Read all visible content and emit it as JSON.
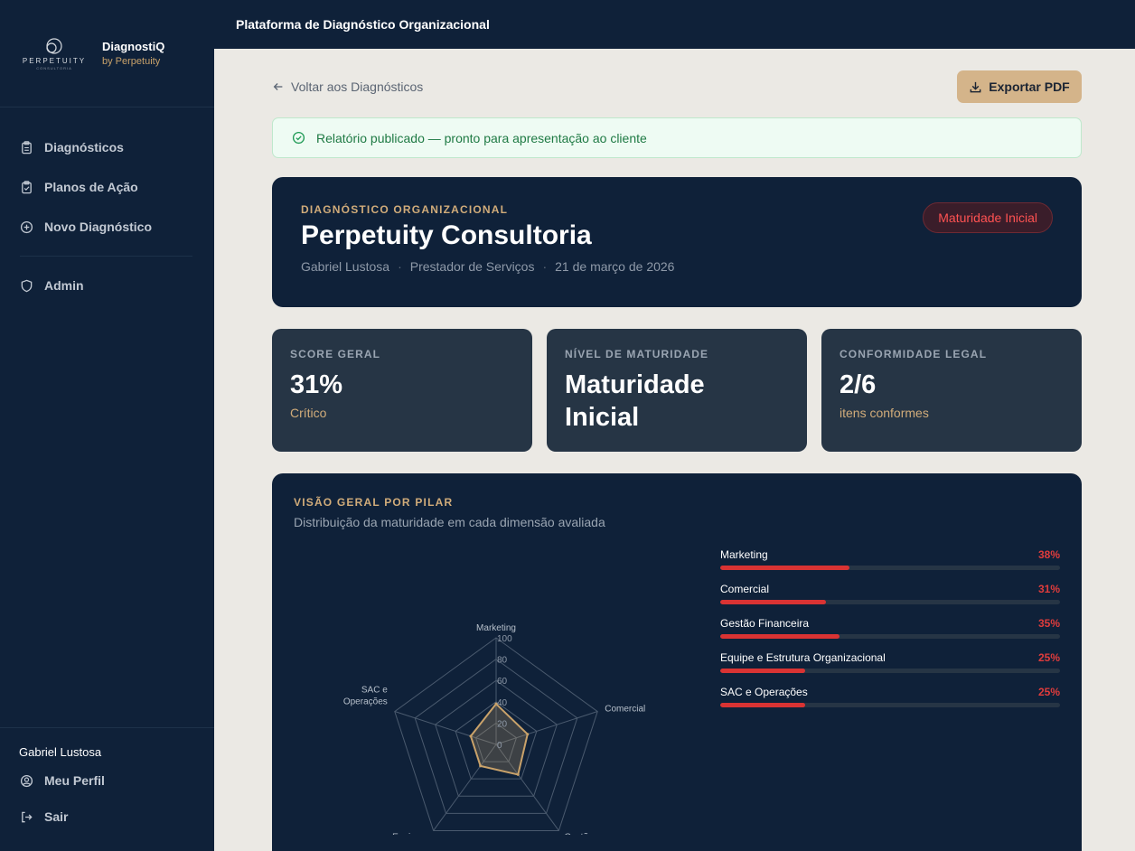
{
  "sidebar": {
    "brand": {
      "logo_word": "PERPETUITY",
      "logo_sub": "CONSULTORIA",
      "name": "DiagnostiQ",
      "by": "by Perpetuity"
    },
    "items": [
      {
        "label": "Diagnósticos",
        "icon": "clipboard-icon"
      },
      {
        "label": "Planos de Ação",
        "icon": "clipboard-check-icon"
      },
      {
        "label": "Novo Diagnóstico",
        "icon": "plus-circle-icon"
      },
      {
        "label": "Admin",
        "icon": "shield-icon"
      }
    ],
    "user_name": "Gabriel Lustosa",
    "profile_label": "Meu Perfil",
    "logout_label": "Sair"
  },
  "topbar": {
    "title": "Plataforma de Diagnóstico Organizacional"
  },
  "actions": {
    "back_label": "Voltar aos Diagnósticos",
    "export_label": "Exportar PDF"
  },
  "alert": {
    "text": "Relatório publicado — pronto para apresentação ao cliente"
  },
  "hero": {
    "kicker": "DIAGNÓSTICO ORGANIZACIONAL",
    "title": "Perpetuity Consultoria",
    "author": "Gabriel Lustosa",
    "segment": "Prestador de Serviços",
    "date": "21 de março de 2026",
    "badge": "Maturidade Inicial"
  },
  "stats": [
    {
      "label": "SCORE GERAL",
      "value": "31%",
      "sub": "Crítico"
    },
    {
      "label": "NÍVEL DE MATURIDADE",
      "value": "Maturidade Inicial",
      "sub": ""
    },
    {
      "label": "CONFORMIDADE LEGAL",
      "value": "2/6",
      "sub": "itens conformes"
    }
  ],
  "pillars": {
    "kicker": "VISÃO GERAL POR PILAR",
    "description": "Distribuição da maturidade em cada dimensão avaliada",
    "items": [
      {
        "label": "Marketing",
        "pct_label": "38%",
        "value": 38
      },
      {
        "label": "Comercial",
        "pct_label": "31%",
        "value": 31
      },
      {
        "label": "Gestão Financeira",
        "pct_label": "35%",
        "value": 35
      },
      {
        "label": "Equipe e Estrutura Organizacional",
        "pct_label": "25%",
        "value": 25
      },
      {
        "label": "SAC e Operações",
        "pct_label": "25%",
        "value": 25
      }
    ]
  },
  "chart_data": {
    "type": "radar",
    "categories": [
      "Marketing",
      "Comercial",
      "Gestão Financeira",
      "Equipe e Estrutura Organizacional",
      "SAC e Operações"
    ],
    "axis_labels": [
      [
        "Marketing"
      ],
      [
        "Comercial"
      ],
      [
        "Gestão",
        "Financeira"
      ],
      [
        "Equipe e",
        "Estrutura Organizacional"
      ],
      [
        "SAC e",
        "Operações"
      ]
    ],
    "values": [
      38,
      31,
      35,
      25,
      25
    ],
    "ylim": [
      0,
      100
    ],
    "ticks": [
      "0",
      "20",
      "40",
      "60",
      "80",
      "100"
    ],
    "grid": true,
    "colors": {
      "fill": "#c9a26a",
      "grid": "#4a5a6e",
      "label": "#b7c0cb"
    }
  }
}
